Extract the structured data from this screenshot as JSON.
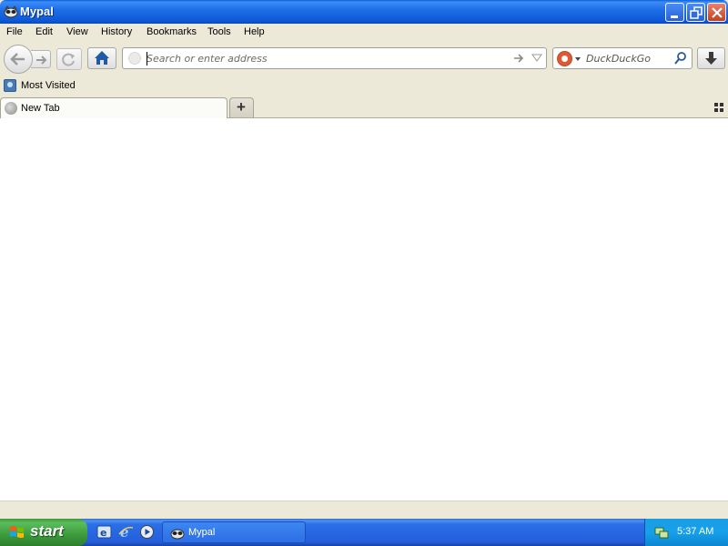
{
  "window": {
    "title": "Mypal",
    "buttons": [
      "minimize",
      "restore",
      "close"
    ]
  },
  "menu": [
    "File",
    "Edit",
    "View",
    "History",
    "Bookmarks",
    "Tools",
    "Help"
  ],
  "navbar": {
    "url_placeholder": "Search or enter address",
    "search_engine": "DuckDuckGo",
    "icons": [
      "back-icon",
      "forward-icon",
      "reload-icon",
      "home-icon",
      "go-arrow-icon",
      "history-dropdown-icon",
      "search-icon",
      "download-icon"
    ]
  },
  "bookmarks": {
    "items": [
      "Most Visited"
    ]
  },
  "tabs": [
    {
      "label": "New Tab",
      "active": true
    }
  ],
  "taskbar": {
    "start_label": "start",
    "task_label": "Mypal",
    "clock": "5:37 AM"
  },
  "colors": {
    "titlebar": "#0d58d6",
    "taskbar": "#245edc",
    "start": "#3c9a3c",
    "chrome": "#ece9d8"
  }
}
